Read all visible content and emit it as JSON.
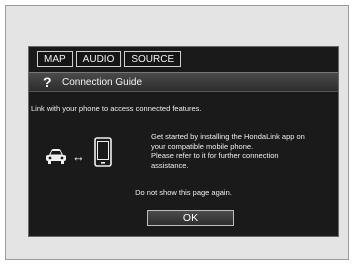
{
  "tabs": [
    {
      "label": "MAP"
    },
    {
      "label": "AUDIO"
    },
    {
      "label": "SOURCE"
    }
  ],
  "header": {
    "title": "Connection Guide",
    "help_symbol": "?"
  },
  "intro_text": "Link with your phone to access connected features.",
  "connection_arrow": "↔",
  "guide_lines": [
    "Get started by installing the HondaLink app on",
    "your compatible mobile phone.",
    "Please refer to it for further connection",
    "assistance."
  ],
  "dont_show_label": "Do not show this page again.",
  "ok_label": "OK",
  "icons": {
    "car": "car-icon",
    "phone": "smartphone-icon",
    "help": "question-mark-icon"
  },
  "colors": {
    "screen_bg": "#1a1a1a",
    "frame_bg": "#e4e4e4",
    "text": "#f0f0f0"
  }
}
